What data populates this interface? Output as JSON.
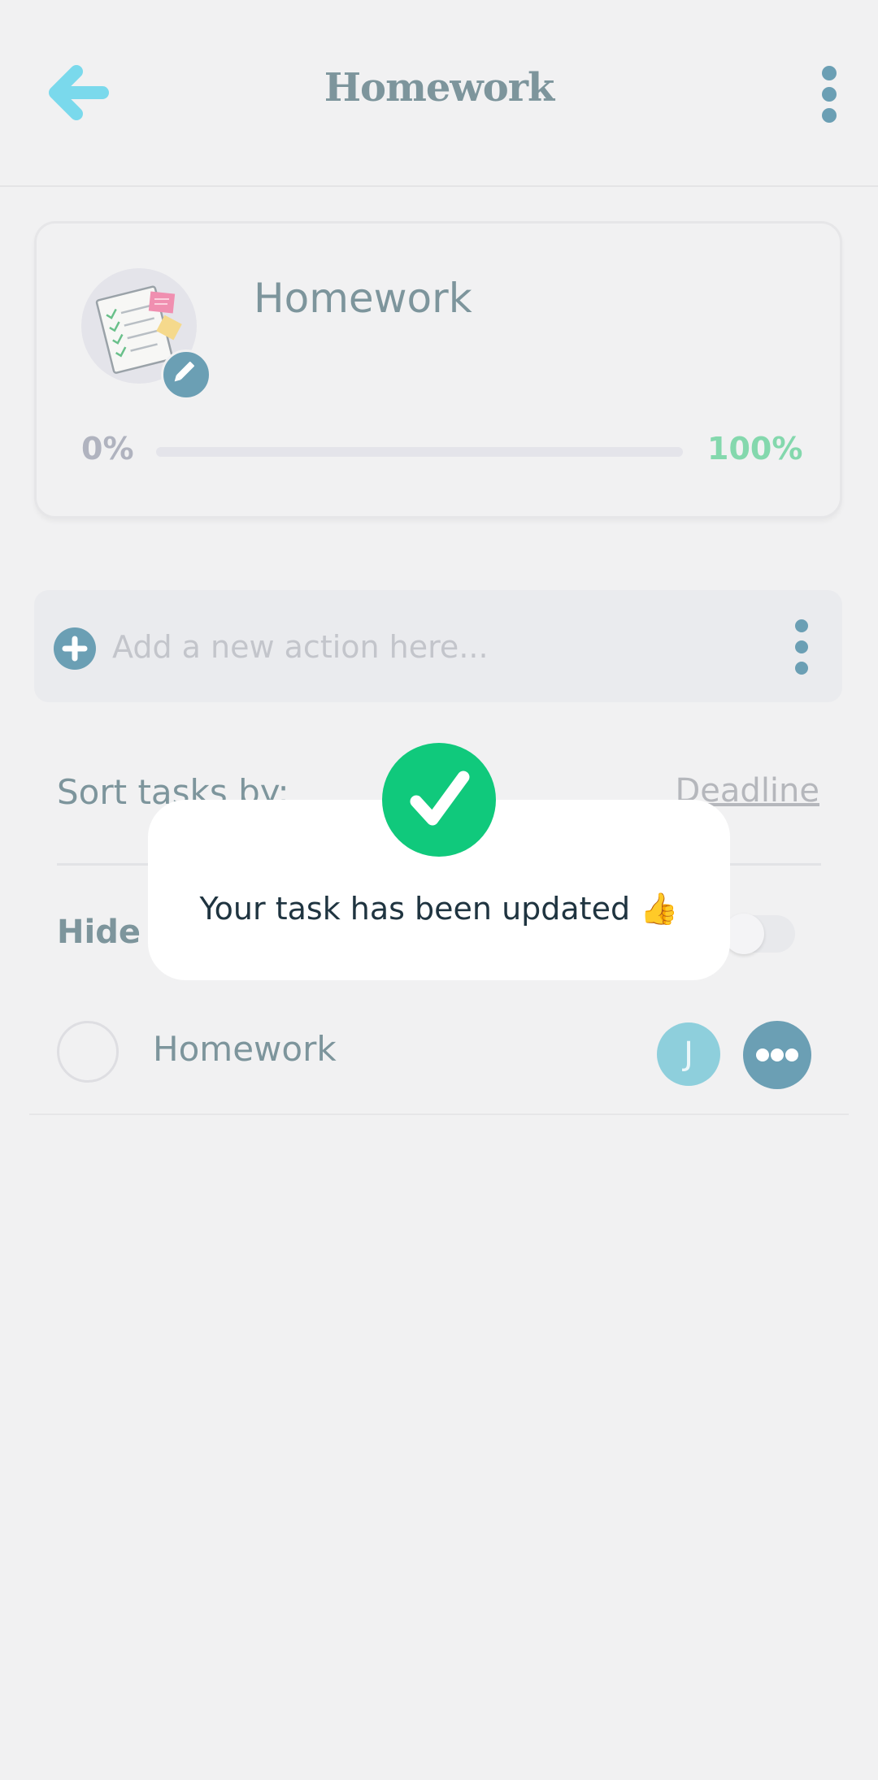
{
  "header": {
    "title": "Homework",
    "back_icon": "arrow-left-icon",
    "menu_icon": "vertical-ellipsis-icon"
  },
  "project": {
    "name": "Homework",
    "image_icon": "checklist-document-icon",
    "edit_icon": "pencil-icon",
    "progress_start_label": "0%",
    "progress_end_label": "100%",
    "progress_fraction": 0
  },
  "add_action": {
    "placeholder": "Add a new action here...",
    "add_icon": "plus-icon",
    "menu_icon": "vertical-ellipsis-icon"
  },
  "sort": {
    "label": "Sort tasks by:",
    "value": "Deadline"
  },
  "hide_completed": {
    "label": "Hide c",
    "enabled": false
  },
  "tasks": [
    {
      "title": "Homework",
      "assignee_initial": "J",
      "more_icon": "horizontal-ellipsis-icon"
    }
  ],
  "toast": {
    "message": "Your task has been updated 👍",
    "icon": "check-icon"
  },
  "colors": {
    "background": "#f1f1f2",
    "accent_teal": "#6b9fb4",
    "back_arrow": "#7ad9ec",
    "success_green": "#10c97c",
    "progress_end": "#84d8ad",
    "title_text": "#7d959c"
  }
}
